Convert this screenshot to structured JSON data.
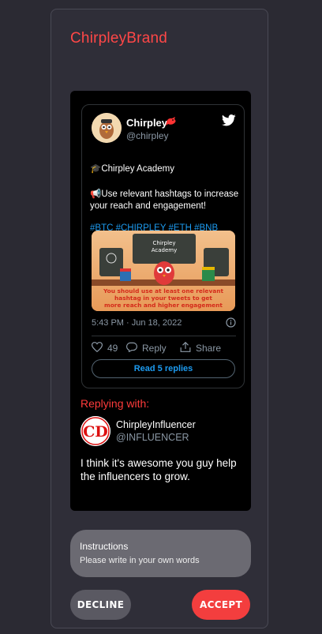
{
  "brand": "ChirpleyBrand",
  "tweet": {
    "display_name": "Chirpley",
    "handle": "@chirpley",
    "line1": "🎓Chirpley Academy",
    "line2a": "📢Use relevant hashtags to increase",
    "line2b": "your reach and engagement!",
    "hashtags": "#BTC #CHIRPLEY #ETH #BNB",
    "media": {
      "board_line1": "Chirpley",
      "board_line2": "Academy",
      "caption1": "You should use at least one relevant",
      "caption2": "hashtag in your tweets to get",
      "caption3": "more reach and higher engagement"
    },
    "timestamp": "5:43 PM · Jun 18, 2022",
    "likes": "49",
    "reply_label": "Reply",
    "share_label": "Share",
    "read_replies": "Read 5 replies"
  },
  "reply": {
    "label": "Replying with:",
    "name": "ChirpleyInfluencer",
    "handle": "@INFLUENCER",
    "text": "I think it's awesome you guy help the influencers to grow.",
    "avatar_text": "CD"
  },
  "instructions": {
    "title": "Instructions",
    "body": "Please write in your own words"
  },
  "buttons": {
    "decline": "DECLINE",
    "accept": "ACCEPT"
  },
  "colors": {
    "background": "#2b2a33",
    "brand_red": "#ff4747",
    "link_blue": "#1d9bf0",
    "accept": "#f33e3e",
    "decline": "#5a5962"
  }
}
